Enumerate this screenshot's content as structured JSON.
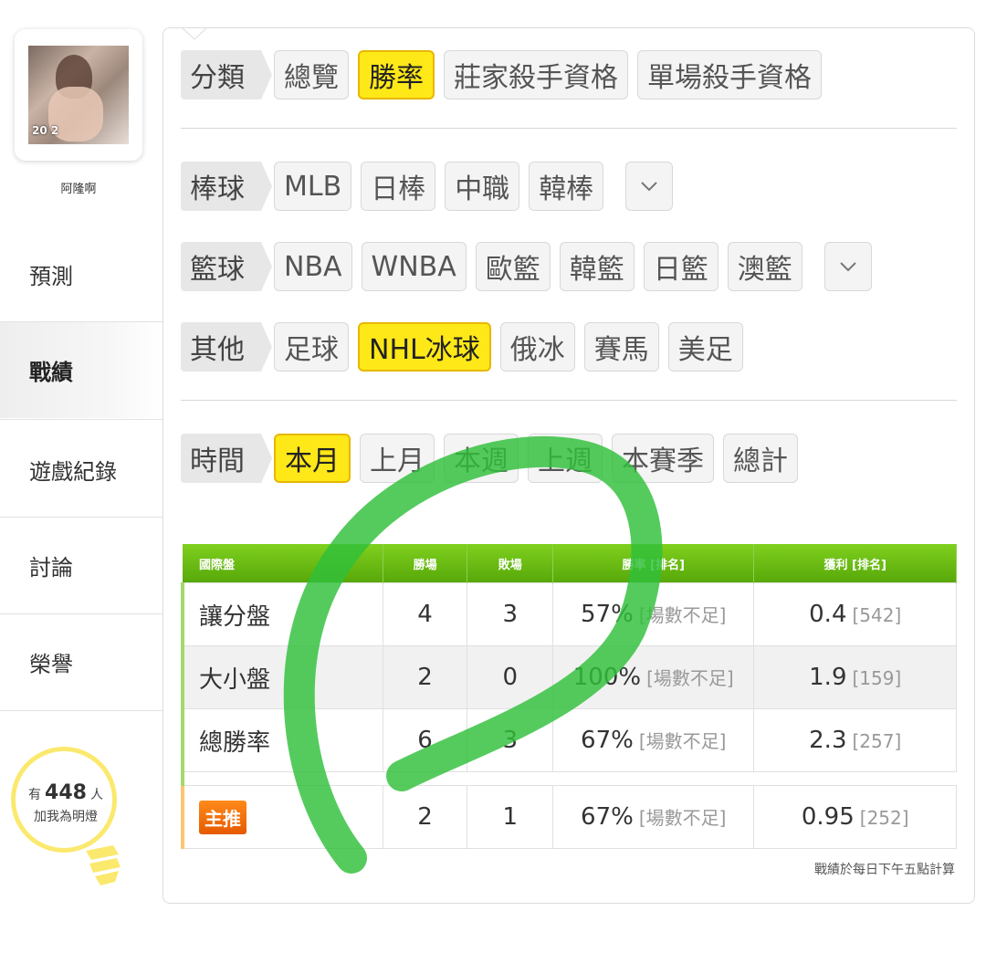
{
  "sidebar": {
    "avatar_badge": "20 2",
    "username": "阿隆啊",
    "nav": [
      "預測",
      "戰績",
      "遊戲紀錄",
      "討論",
      "榮譽"
    ],
    "active_nav": "戰績",
    "fans": {
      "prefix": "有",
      "count": "448",
      "suffix": "人",
      "caption": "加我為明燈"
    }
  },
  "filters": {
    "category": {
      "label": "分類",
      "options": [
        "總覽",
        "勝率",
        "莊家殺手資格",
        "單場殺手資格"
      ],
      "active": "勝率"
    },
    "baseball": {
      "label": "棒球",
      "options": [
        "MLB",
        "日棒",
        "中職",
        "韓棒"
      ]
    },
    "basketball": {
      "label": "籃球",
      "options": [
        "NBA",
        "WNBA",
        "歐籃",
        "韓籃",
        "日籃",
        "澳籃"
      ]
    },
    "other": {
      "label": "其他",
      "options": [
        "足球",
        "NHL冰球",
        "俄冰",
        "賽馬",
        "美足"
      ],
      "active": "NHL冰球"
    },
    "time": {
      "label": "時間",
      "options": [
        "本月",
        "上月",
        "本週",
        "上週",
        "本賽季",
        "總計"
      ],
      "active": "本月"
    }
  },
  "stats_table": {
    "headers": [
      "國際盤",
      "勝場",
      "敗場",
      "勝率 [排名]",
      "獲利 [排名]"
    ],
    "rows": [
      {
        "type": "讓分盤",
        "win": "4",
        "loss": "3",
        "rate": "57%",
        "rate_rank": "[場數不足]",
        "profit": "0.4",
        "profit_rank": "[542]"
      },
      {
        "type": "大小盤",
        "win": "2",
        "loss": "0",
        "rate": "100%",
        "rate_rank": "[場數不足]",
        "profit": "1.9",
        "profit_rank": "[159]"
      },
      {
        "type": "總勝率",
        "win": "6",
        "loss": "3",
        "rate": "67%",
        "rate_rank": "[場數不足]",
        "profit": "2.3",
        "profit_rank": "[257]"
      }
    ],
    "main_pick": {
      "label": "主推",
      "win": "2",
      "loss": "1",
      "rate": "67%",
      "rate_rank": "[場數不足]",
      "profit": "0.95",
      "profit_rank": "[252]"
    },
    "footnote": "戰績於每日下午五點計算"
  },
  "colors": {
    "accent_yellow": "#ffe818",
    "header_green": "#6cbf14",
    "marker_green": "#2fbf3a",
    "main_orange": "#f07010"
  }
}
